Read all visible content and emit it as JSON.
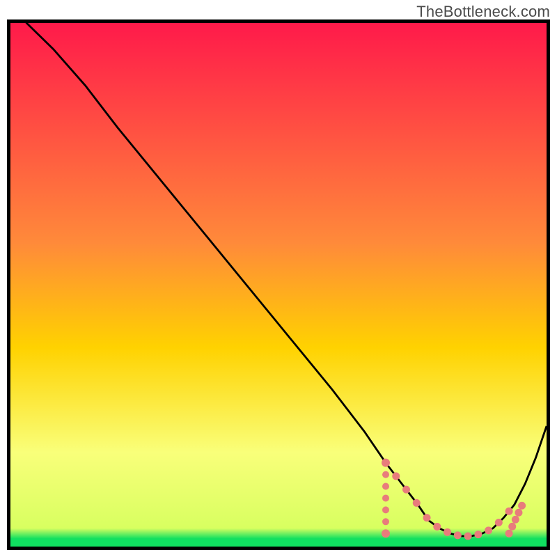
{
  "watermark": "TheBottleneck.com",
  "colors": {
    "border": "#000000",
    "curve": "#000000",
    "marker": "#e87c7c",
    "gradient_top": "#ff1a4a",
    "gradient_mid": "#ffd200",
    "gradient_low": "#f9ff7a",
    "gradient_bottom": "#10e060"
  },
  "chart_data": {
    "type": "line",
    "title": "",
    "xlabel": "",
    "ylabel": "",
    "xlim": [
      0,
      100
    ],
    "ylim": [
      0,
      100
    ],
    "x": [
      0,
      3,
      8,
      14,
      20,
      28,
      36,
      44,
      52,
      60,
      66,
      70,
      73,
      76,
      78,
      80,
      82,
      84,
      86,
      88,
      90,
      92,
      94,
      96,
      98,
      100
    ],
    "values": [
      105,
      100,
      95,
      88,
      80,
      70,
      60,
      50,
      40,
      30,
      22,
      16,
      12,
      8,
      5,
      3.5,
      2.5,
      2,
      2,
      2.5,
      3.5,
      5.5,
      8,
      12,
      17,
      23
    ],
    "highlight_band": {
      "xstart": 70,
      "xend": 93,
      "y": 2.5
    },
    "gradient_stops": [
      {
        "offset": 0.0,
        "y": 100
      },
      {
        "offset": 0.55,
        "y": 45
      },
      {
        "offset": 0.82,
        "y": 18
      },
      {
        "offset": 0.93,
        "y": 7
      },
      {
        "offset": 1.0,
        "y": 0
      }
    ]
  }
}
